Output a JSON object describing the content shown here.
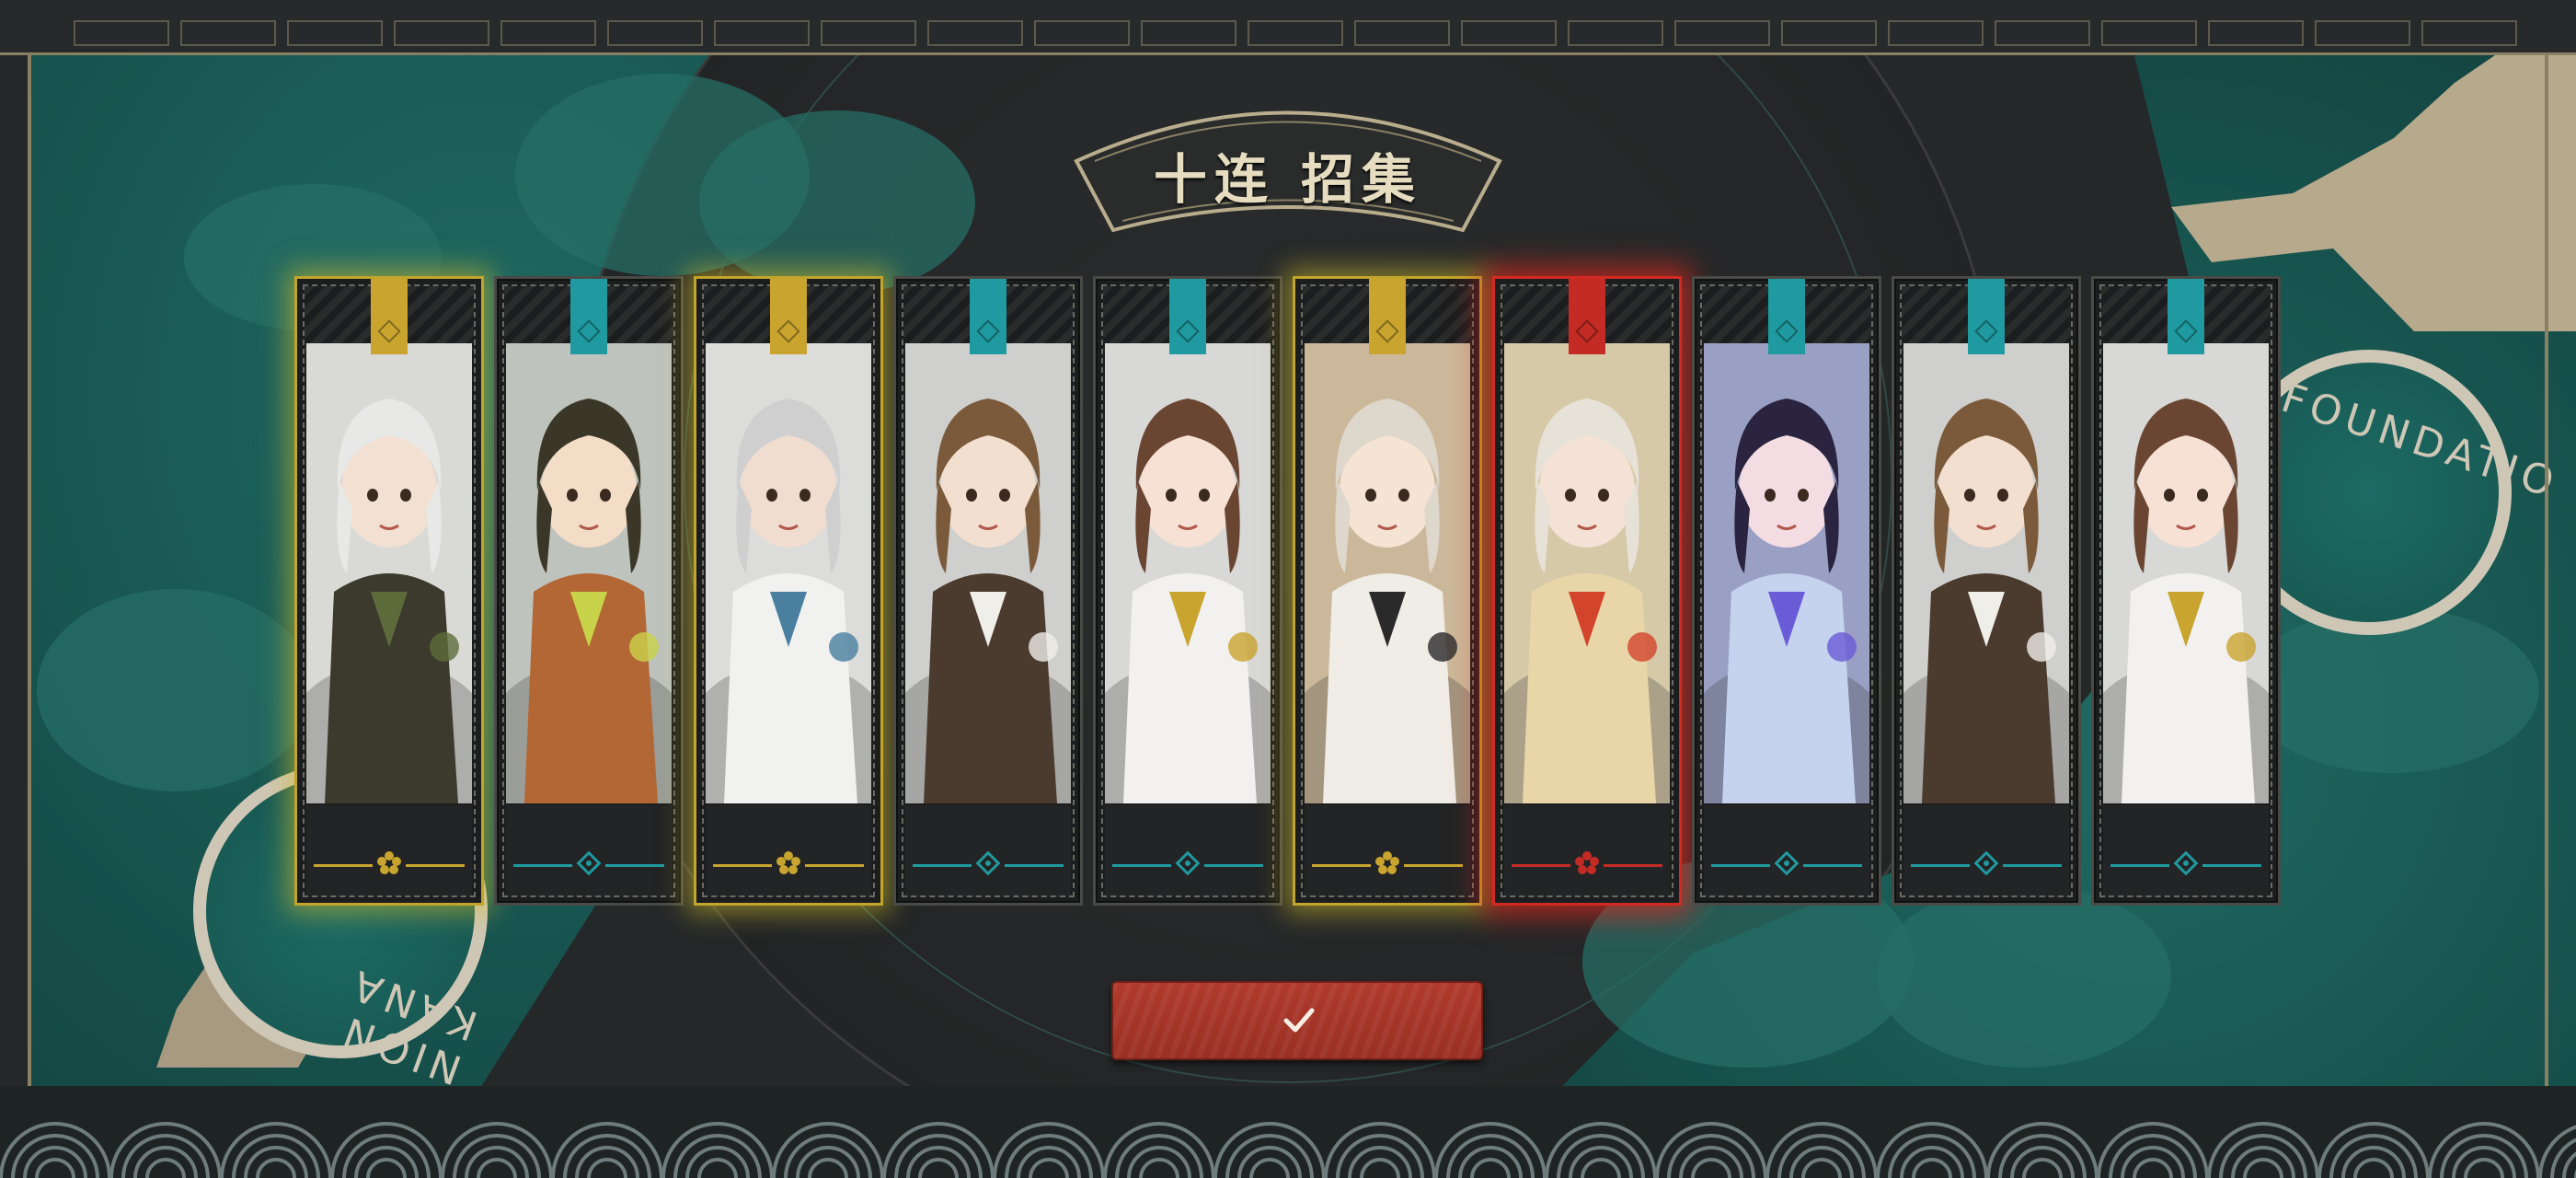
{
  "title": "十连 招集",
  "seal_left_text": "NION KANA",
  "seal_right_text": "FOUNDATIO",
  "colors": {
    "gold": "#c9a42e",
    "teal": "#1f9aa0",
    "red": "#c42b25",
    "button": "#a8362a"
  },
  "cards": [
    {
      "rarity": "gold",
      "emblem": "flower-icon",
      "portrait": "silver-haired-man-with-glasses"
    },
    {
      "rarity": "teal",
      "emblem": "diamond-knot-icon",
      "portrait": "girl-with-yellow-hat"
    },
    {
      "rarity": "gold",
      "emblem": "flower-icon",
      "portrait": "white-haired-man-blue-scarf"
    },
    {
      "rarity": "teal",
      "emblem": "diamond-knot-icon",
      "portrait": "brown-haired-man-glasses"
    },
    {
      "rarity": "teal",
      "emblem": "diamond-knot-icon",
      "portrait": "smiling-woman-white-dress"
    },
    {
      "rarity": "gold",
      "emblem": "flower-icon",
      "portrait": "blonde-girl-black-vest"
    },
    {
      "rarity": "red",
      "emblem": "red-flower-icon",
      "portrait": "woman-with-flowers"
    },
    {
      "rarity": "teal",
      "emblem": "diamond-knot-icon",
      "portrait": "purple-eyed-girl-winking"
    },
    {
      "rarity": "teal",
      "emblem": "diamond-knot-icon",
      "portrait": "brown-haired-man-glasses"
    },
    {
      "rarity": "teal",
      "emblem": "diamond-knot-icon",
      "portrait": "smiling-woman-white-dress"
    }
  ],
  "confirm_button": {
    "icon": "checkmark-icon"
  }
}
